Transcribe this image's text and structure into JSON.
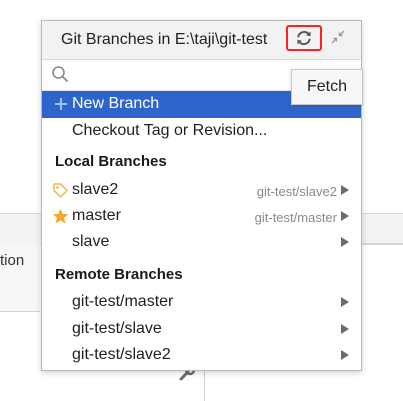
{
  "popup": {
    "title": "Git Branches in E:\\taji\\git-test",
    "search_placeholder": "",
    "refresh_tooltip": "Fetch"
  },
  "actions": [
    {
      "label": "New Branch"
    },
    {
      "label": "Checkout Tag or Revision..."
    }
  ],
  "local_branches": {
    "header": "Local Branches",
    "items": [
      {
        "name": "slave2",
        "tracking": "git-test/slave2",
        "icon": "tag-icon"
      },
      {
        "name": "master",
        "tracking": "git-test/master",
        "icon": "star-icon"
      },
      {
        "name": "slave",
        "tracking": "",
        "icon": ""
      }
    ]
  },
  "remote_branches": {
    "header": "Remote Branches",
    "items": [
      {
        "name": "git-test/master"
      },
      {
        "name": "git-test/slave"
      },
      {
        "name": "git-test/slave2"
      }
    ]
  },
  "background": {
    "left_panel_text": "tion"
  },
  "colors": {
    "selection": "#2f65ca",
    "highlight_border": "#ff2020",
    "star": "#f5a623",
    "tag": "#f0b64a"
  }
}
